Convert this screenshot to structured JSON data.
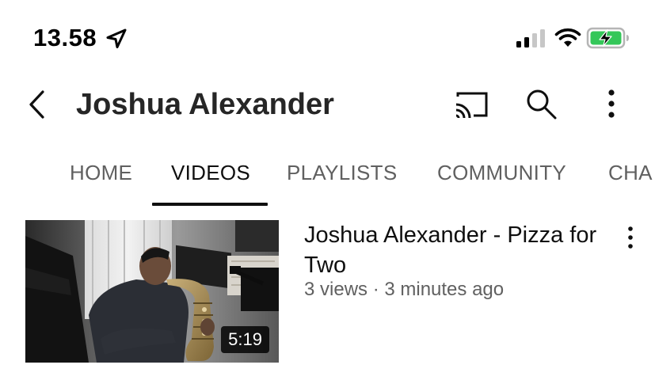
{
  "status_bar": {
    "time": "13.58",
    "battery_color": "#34c759"
  },
  "header": {
    "channel_name": "Joshua Alexander",
    "icons": [
      "back-icon",
      "cast-icon",
      "search-icon",
      "more-vertical-icon"
    ]
  },
  "tabs": {
    "items": [
      {
        "label": "HOME",
        "active": false
      },
      {
        "label": "VIDEOS",
        "active": true
      },
      {
        "label": "PLAYLISTS",
        "active": false
      },
      {
        "label": "COMMUNITY",
        "active": false
      },
      {
        "label": "CHA",
        "active": false
      }
    ]
  },
  "videos": [
    {
      "title": "Joshua Alexander - Pizza for Two",
      "meta": "3 views · 3 minutes ago",
      "duration": "5:19"
    }
  ]
}
